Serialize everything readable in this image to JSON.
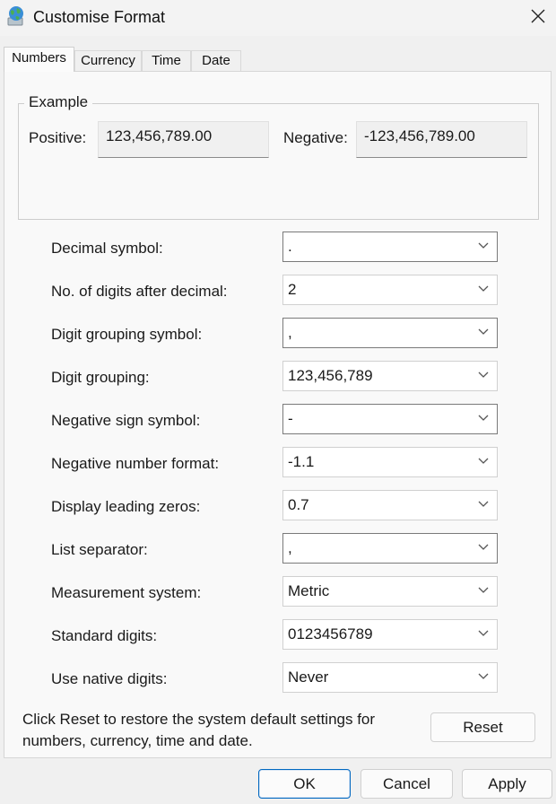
{
  "window": {
    "title": "Customise Format",
    "icon": "globe-icon"
  },
  "tabs": [
    "Numbers",
    "Currency",
    "Time",
    "Date"
  ],
  "example": {
    "group_label": "Example",
    "positive_label": "Positive:",
    "positive_value": "123,456,789.00",
    "negative_label": "Negative:",
    "negative_value": "-123,456,789.00"
  },
  "settings": [
    {
      "label": "Decimal symbol:",
      "value": "."
    },
    {
      "label": "No. of digits after decimal:",
      "value": "2"
    },
    {
      "label": "Digit grouping symbol:",
      "value": ","
    },
    {
      "label": "Digit grouping:",
      "value": "123,456,789"
    },
    {
      "label": "Negative sign symbol:",
      "value": "-"
    },
    {
      "label": "Negative number format:",
      "value": "-1.1"
    },
    {
      "label": "Display leading zeros:",
      "value": "0.7"
    },
    {
      "label": "List separator:",
      "value": ","
    },
    {
      "label": "Measurement system:",
      "value": "Metric"
    },
    {
      "label": "Standard digits:",
      "value": "0123456789"
    },
    {
      "label": "Use native digits:",
      "value": "Never"
    }
  ],
  "reset_note": {
    "line1": "Click Reset to restore the system default settings for",
    "line2": "numbers, currency, time and date."
  },
  "buttons": {
    "reset": "Reset",
    "ok": "OK",
    "cancel": "Cancel",
    "apply": "Apply"
  },
  "colors": {
    "accent": "#0067c0",
    "window_bg": "#f0f0f0",
    "panel_bg": "#f9f9f9"
  }
}
